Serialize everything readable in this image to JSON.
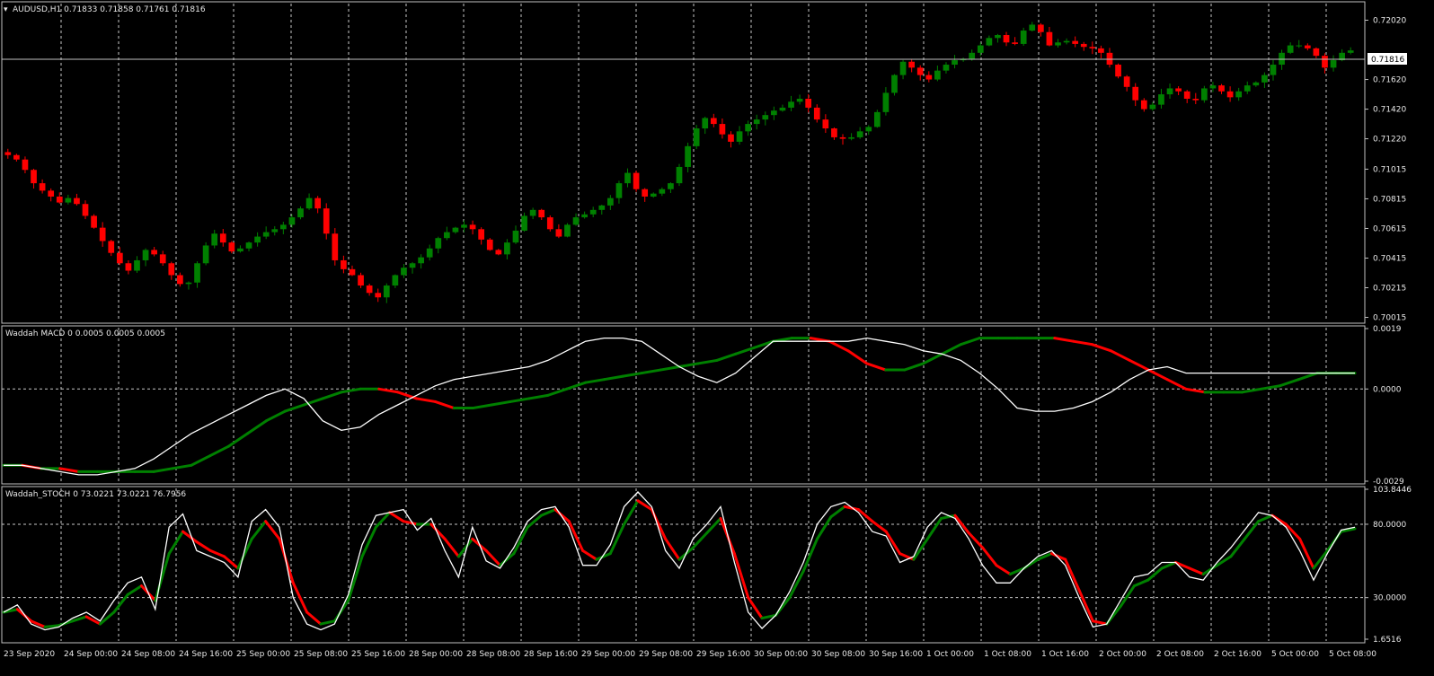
{
  "colors": {
    "background": "#000000",
    "grid": "#c8c8c8",
    "bull": "#008000",
    "bear": "#ff0000",
    "signal_line": "#ffffff",
    "frame": "#c0c0c0",
    "price_label_bg": "#ffffff",
    "price_label_fg": "#000000"
  },
  "price_pane": {
    "label": "AUDUSD,H1  0.71833 0.71858 0.71761 0.71816",
    "icon": "triangle-down-icon",
    "current_price": "0.71816",
    "y_ticks": [
      "0.72020",
      "0.71816",
      "0.71620",
      "0.71420",
      "0.71220",
      "0.71015",
      "0.70815",
      "0.70615",
      "0.70415",
      "0.70215",
      "0.70015"
    ]
  },
  "macd_pane": {
    "label": "Waddah MACD 0 0.0005 0.0005 0.0005",
    "y_ticks": [
      "0.0019",
      "0.0000",
      "-0.0029"
    ]
  },
  "stoch_pane": {
    "label": "Waddah_STOCH 0 73.0221 73.0221 76.7956",
    "y_ticks": [
      "103.8446",
      "80.0000",
      "30.0000",
      "1.6516"
    ]
  },
  "x_ticks": [
    "23 Sep 2020",
    "24 Sep 00:00",
    "24 Sep 08:00",
    "24 Sep 16:00",
    "25 Sep 00:00",
    "25 Sep 08:00",
    "25 Sep 16:00",
    "28 Sep 00:00",
    "28 Sep 08:00",
    "28 Sep 16:00",
    "29 Sep 00:00",
    "29 Sep 08:00",
    "29 Sep 16:00",
    "30 Sep 00:00",
    "30 Sep 08:00",
    "30 Sep 16:00",
    "1 Oct 00:00",
    "1 Oct 08:00",
    "1 Oct 16:00",
    "2 Oct 00:00",
    "2 Oct 08:00",
    "2 Oct 16:00",
    "5 Oct 00:00",
    "5 Oct 08:00"
  ],
  "chart_data": [
    {
      "type": "candlestick",
      "title": "AUDUSD,H1",
      "ylim": [
        0.7,
        0.7212
      ],
      "close_series": [
        0.7111,
        0.7108,
        0.7101,
        0.7092,
        0.7087,
        0.7083,
        0.7079,
        0.7082,
        0.7078,
        0.707,
        0.7062,
        0.7053,
        0.7045,
        0.7038,
        0.7033,
        0.704,
        0.7047,
        0.7044,
        0.7038,
        0.703,
        0.7024,
        0.7025,
        0.7038,
        0.705,
        0.7058,
        0.7052,
        0.7046,
        0.7048,
        0.7052,
        0.7056,
        0.7059,
        0.7061,
        0.7064,
        0.7069,
        0.7075,
        0.7082,
        0.7075,
        0.7058,
        0.704,
        0.7034,
        0.703,
        0.7023,
        0.7018,
        0.7015,
        0.7023,
        0.703,
        0.7035,
        0.7038,
        0.7042,
        0.7048,
        0.7055,
        0.7059,
        0.7062,
        0.7064,
        0.7061,
        0.7054,
        0.7047,
        0.7044,
        0.7052,
        0.706,
        0.707,
        0.7074,
        0.7069,
        0.7061,
        0.7056,
        0.7064,
        0.7069,
        0.7071,
        0.7074,
        0.7077,
        0.7082,
        0.7092,
        0.7099,
        0.7088,
        0.7083,
        0.7085,
        0.7088,
        0.7092,
        0.7103,
        0.7117,
        0.7129,
        0.7136,
        0.7132,
        0.7125,
        0.712,
        0.7127,
        0.7132,
        0.7135,
        0.7138,
        0.7141,
        0.7143,
        0.7147,
        0.7149,
        0.7143,
        0.7135,
        0.7129,
        0.7123,
        0.7122,
        0.7123,
        0.7127,
        0.713,
        0.714,
        0.7153,
        0.7165,
        0.7174,
        0.717,
        0.7165,
        0.7162,
        0.7168,
        0.7172,
        0.7175,
        0.7176,
        0.718,
        0.7185,
        0.719,
        0.7192,
        0.7187,
        0.7186,
        0.7195,
        0.7199,
        0.7194,
        0.7185,
        0.7187,
        0.7188,
        0.7186,
        0.7184,
        0.7183,
        0.718,
        0.7172,
        0.7164,
        0.7157,
        0.7148,
        0.7142,
        0.7145,
        0.7152,
        0.7156,
        0.7154,
        0.7149,
        0.7148,
        0.7156,
        0.7158,
        0.7154,
        0.715,
        0.7154,
        0.7158,
        0.716,
        0.7165,
        0.7172,
        0.718,
        0.7185,
        0.7185,
        0.7183,
        0.7178,
        0.717,
        0.7175,
        0.718,
        0.71816
      ],
      "last_price": 0.71816
    },
    {
      "type": "line",
      "title": "Waddah MACD",
      "ylim": [
        -0.0029,
        0.0019
      ],
      "zero_line": 0.0,
      "series": [
        {
          "values": [
            -0.0024,
            -0.0024,
            -0.0025,
            -0.0025,
            -0.0026,
            -0.0026,
            -0.0026,
            -0.0026,
            -0.0026,
            -0.0025,
            -0.0024,
            -0.0021,
            -0.0018,
            -0.0014,
            -0.001,
            -0.0007,
            -0.0005,
            -0.0003,
            -0.0001,
            0.0,
            0.0,
            -0.0001,
            -0.0003,
            -0.0004,
            -0.0006,
            -0.0006,
            -0.0005,
            -0.0004,
            -0.0003,
            -0.0002,
            0.0,
            0.0002,
            0.0003,
            0.0004,
            0.0005,
            0.0006,
            0.0007,
            0.0008,
            0.0009,
            0.0011,
            0.0013,
            0.0015,
            0.0016,
            0.0016,
            0.0015,
            0.0012,
            0.0008,
            0.0006,
            0.0006,
            0.0008,
            0.0011,
            0.0014,
            0.0016,
            0.0016,
            0.0016,
            0.0016,
            0.0016,
            0.0015,
            0.0014,
            0.0012,
            0.0009,
            0.0006,
            0.0003,
            0.0,
            -0.0001,
            -0.0001,
            -0.0001,
            0.0,
            0.0001,
            0.0003,
            0.0005,
            0.0005,
            0.0005
          ]
        },
        {
          "values": [
            -0.0024,
            -0.0024,
            -0.0025,
            -0.0026,
            -0.0027,
            -0.0027,
            -0.0026,
            -0.0025,
            -0.0022,
            -0.0018,
            -0.0014,
            -0.0011,
            -0.0008,
            -0.0005,
            -0.0002,
            0.0,
            -0.0003,
            -0.001,
            -0.0013,
            -0.0012,
            -0.0008,
            -0.0005,
            -0.0002,
            0.0001,
            0.0003,
            0.0004,
            0.0005,
            0.0006,
            0.0007,
            0.0009,
            0.0012,
            0.0015,
            0.0016,
            0.0016,
            0.0015,
            0.0011,
            0.0007,
            0.0004,
            0.0002,
            0.0005,
            0.001,
            0.0015,
            0.0015,
            0.0015,
            0.0015,
            0.0015,
            0.0016,
            0.0015,
            0.0014,
            0.0012,
            0.0011,
            0.0009,
            0.0005,
            0.0,
            -0.0006,
            -0.0007,
            -0.0007,
            -0.0006,
            -0.0004,
            -0.0001,
            0.0003,
            0.0006,
            0.0007,
            0.0005,
            0.0005,
            0.0005,
            0.0005,
            0.0005,
            0.0005,
            0.0005,
            0.0005,
            0.0005,
            0.0005
          ]
        }
      ]
    },
    {
      "type": "line",
      "title": "Waddah_STOCH",
      "ylim": [
        1.6516,
        103.8446
      ],
      "levels": [
        80.0,
        30.0
      ],
      "series": [
        {
          "values": [
            20,
            22,
            14,
            10,
            11,
            14,
            17,
            12,
            20,
            32,
            38,
            28,
            60,
            75,
            68,
            62,
            58,
            50,
            70,
            82,
            70,
            40,
            20,
            12,
            14,
            28,
            58,
            78,
            88,
            82,
            80,
            80,
            70,
            58,
            70,
            62,
            52,
            60,
            78,
            86,
            90,
            82,
            62,
            56,
            60,
            80,
            96,
            90,
            70,
            56,
            64,
            74,
            84,
            60,
            30,
            16,
            18,
            30,
            48,
            70,
            85,
            92,
            90,
            82,
            75,
            60,
            56,
            70,
            84,
            86,
            74,
            64,
            52,
            46,
            50,
            56,
            60,
            56,
            35,
            14,
            12,
            24,
            38,
            42,
            50,
            54,
            50,
            46,
            52,
            58,
            70,
            82,
            86,
            80,
            70,
            50,
            62,
            75,
            77
          ]
        },
        {
          "values": [
            20,
            25,
            12,
            8,
            10,
            16,
            20,
            14,
            28,
            40,
            44,
            22,
            78,
            87,
            62,
            58,
            54,
            44,
            82,
            90,
            78,
            30,
            12,
            8,
            12,
            32,
            66,
            86,
            88,
            90,
            76,
            84,
            62,
            44,
            78,
            55,
            50,
            64,
            82,
            90,
            92,
            78,
            52,
            52,
            66,
            92,
            102,
            92,
            62,
            50,
            70,
            80,
            92,
            54,
            20,
            9,
            18,
            34,
            54,
            80,
            92,
            95,
            88,
            75,
            72,
            54,
            58,
            78,
            88,
            84,
            70,
            52,
            40,
            40,
            50,
            58,
            62,
            52,
            30,
            10,
            12,
            28,
            44,
            46,
            54,
            54,
            44,
            42,
            54,
            64,
            76,
            88,
            86,
            78,
            62,
            42,
            60,
            76,
            78
          ]
        }
      ]
    }
  ]
}
